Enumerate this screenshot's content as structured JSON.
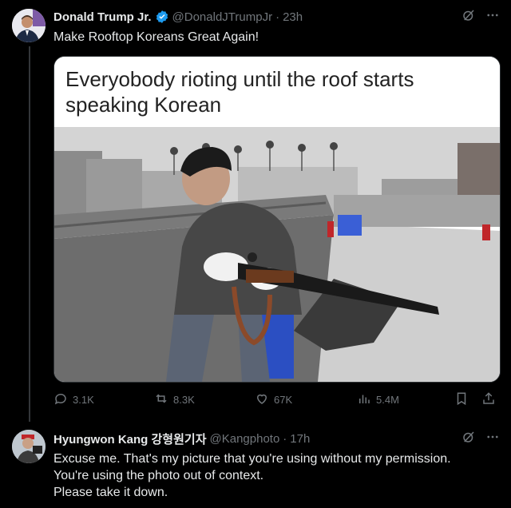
{
  "main_tweet": {
    "name": "Donald Trump Jr.",
    "handle": "@DonaldJTrumpJr",
    "separator": "·",
    "time": "23h",
    "text": "Make Rooftop Koreans Great Again!",
    "image_caption": "Everyobody rioting until the roof starts speaking Korean",
    "stats": {
      "replies": "3.1K",
      "retweets": "8.3K",
      "likes": "67K",
      "views": "5.4M"
    }
  },
  "reply_tweet": {
    "name": "Hyungwon Kang 강형원기자",
    "handle": "@Kangphoto",
    "separator": "·",
    "time": "17h",
    "text": "Excuse me.  That's my picture that you're using without my permission.\nYou're using the photo out of context.\n Please take it down."
  },
  "colors": {
    "background": "#000000",
    "text": "#e7e9ea",
    "muted": "#71767b",
    "verified": "#1d9bf0"
  },
  "icons": [
    "verified-badge-icon",
    "grok-icon",
    "more-icon",
    "reply-icon",
    "retweet-icon",
    "like-icon",
    "views-icon",
    "bookmark-icon",
    "share-icon"
  ]
}
